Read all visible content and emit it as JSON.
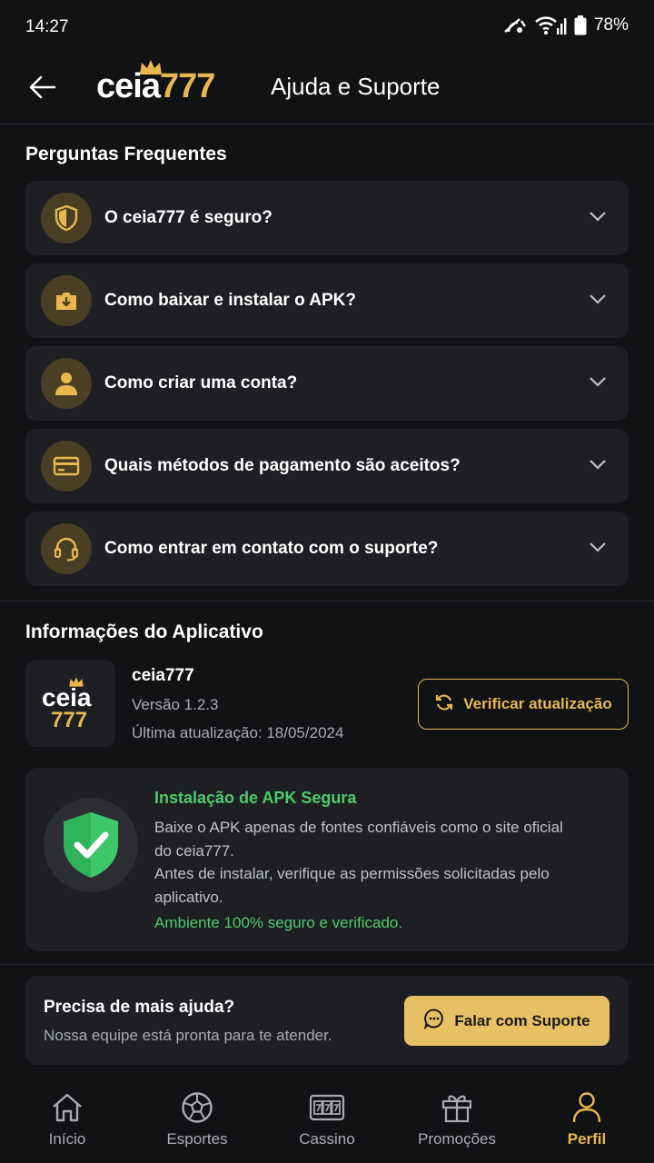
{
  "status_bar": {
    "time": "14:27",
    "battery": "78%"
  },
  "header": {
    "logo_text_white": "ceia",
    "logo_text_gold": "777",
    "title": "Ajuda e Suporte"
  },
  "faq": {
    "title": "Perguntas Frequentes",
    "items": [
      {
        "icon": "shield-icon",
        "question": "O ceia777 é seguro?"
      },
      {
        "icon": "download-icon",
        "question": "Como baixar e instalar o APK?"
      },
      {
        "icon": "user-icon",
        "question": "Como criar uma conta?"
      },
      {
        "icon": "card-icon",
        "question": "Quais métodos de pagamento são aceitos?"
      },
      {
        "icon": "headset-icon",
        "question": "Como entrar em contato com o suporte?"
      }
    ]
  },
  "app_info": {
    "title": "Informações do Aplicativo",
    "logo_white": "ceia",
    "logo_gold": "777",
    "name": "ceia777",
    "version": "Versão 1.2.3",
    "updated": "Última atualização: 18/05/2024",
    "update_button": "Verificar atualização"
  },
  "secure": {
    "title": "Instalação de APK Segura",
    "body_line1": "Baixe o APK apenas de fontes confiáveis como o site oficial do ceia777.",
    "body_line2": "Antes de instalar, verifique as permissões solicitadas pelo aplicativo.",
    "footer": "Ambiente 100% seguro e verificado."
  },
  "help": {
    "title": "Precisa de mais ajuda?",
    "subtitle": "Nossa equipe está pronta para te atender.",
    "button": "Falar com Suporte"
  },
  "nav": {
    "items": [
      {
        "icon": "home-icon",
        "label": "Início"
      },
      {
        "icon": "soccer-ball-icon",
        "label": "Esportes"
      },
      {
        "icon": "slot-machine-icon",
        "label": "Cassino"
      },
      {
        "icon": "gift-icon",
        "label": "Promoções"
      },
      {
        "icon": "profile-icon",
        "label": "Perfil",
        "active": true
      }
    ]
  },
  "colors": {
    "accent": "#e8b84f",
    "background": "#111214",
    "card": "#1e1f23",
    "success": "#4ccb6a"
  }
}
